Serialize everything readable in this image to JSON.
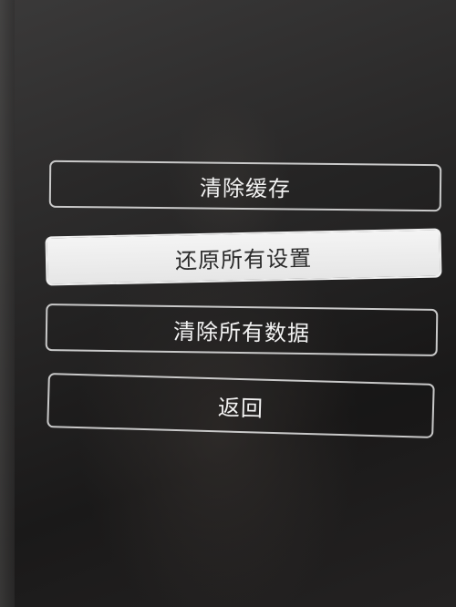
{
  "menu": {
    "items": [
      {
        "label": "清除缓存"
      },
      {
        "label": "还原所有设置"
      },
      {
        "label": "清除所有数据"
      },
      {
        "label": "返回"
      }
    ],
    "selected_index": 1
  },
  "colors": {
    "border": "#c9c9c9",
    "selected_background": "#eeeeee",
    "text": "#f2f2f2",
    "selected_text": "#2a2a2a"
  }
}
